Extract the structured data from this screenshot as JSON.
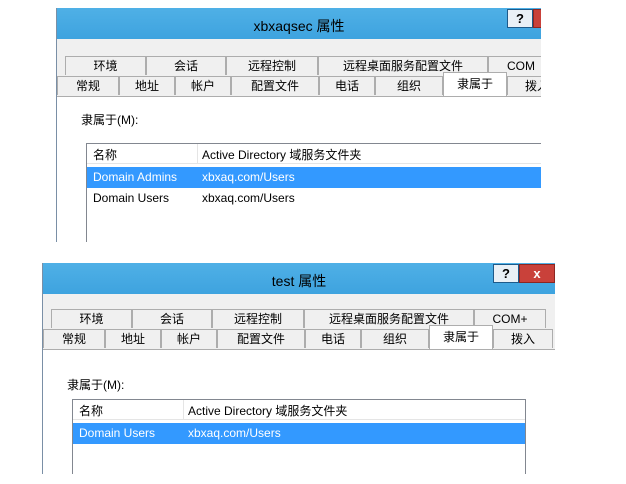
{
  "dialog1": {
    "title": "xbxaqsec 属性",
    "help_label": "?",
    "tabs_row1": [
      "环境",
      "会话",
      "远程控制",
      "远程桌面服务配置文件",
      "COM"
    ],
    "tabs_row2": [
      "常规",
      "地址",
      "帐户",
      "配置文件",
      "电话",
      "组织",
      "隶属于",
      "拨入"
    ],
    "selected_tab": "隶属于",
    "member_of_label": "隶属于(M):",
    "columns": [
      "名称",
      "Active Directory 域服务文件夹"
    ],
    "rows": [
      {
        "name": "Domain Admins",
        "folder": "xbxaq.com/Users",
        "selected": true
      },
      {
        "name": "Domain Users",
        "folder": "xbxaq.com/Users",
        "selected": false
      }
    ]
  },
  "dialog2": {
    "title": "test 属性",
    "help_label": "?",
    "close_label": "x",
    "tabs_row1": [
      "环境",
      "会话",
      "远程控制",
      "远程桌面服务配置文件",
      "COM+"
    ],
    "tabs_row2": [
      "常规",
      "地址",
      "帐户",
      "配置文件",
      "电话",
      "组织",
      "隶属于",
      "拨入"
    ],
    "selected_tab": "隶属于",
    "member_of_label": "隶属于(M):",
    "columns": [
      "名称",
      "Active Directory 域服务文件夹"
    ],
    "rows": [
      {
        "name": "Domain Users",
        "folder": "xbxaq.com/Users",
        "selected": true
      }
    ]
  },
  "colors": {
    "titlebar": "#3ea3df",
    "selection": "#3399ff",
    "close_button": "#c9413a"
  }
}
